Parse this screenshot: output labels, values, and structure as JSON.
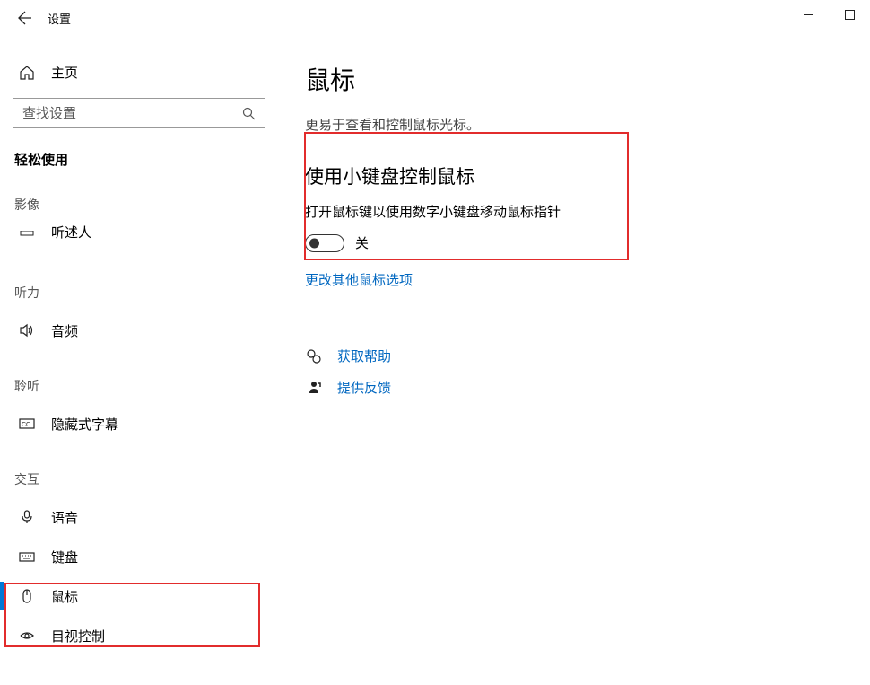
{
  "window": {
    "title": "设置"
  },
  "sidebar": {
    "home_label": "主页",
    "search_placeholder": "查找设置",
    "main_title": "轻松使用",
    "sections": {
      "vision": "影像",
      "hearing": "听力",
      "hearing2": "聆听",
      "interaction": "交互"
    },
    "items": {
      "partial": "听述人",
      "audio": "音频",
      "captions": "隐藏式字幕",
      "speech": "语音",
      "keyboard": "键盘",
      "mouse": "鼠标",
      "eyecontrol": "目视控制"
    }
  },
  "content": {
    "title": "鼠标",
    "subtitle": "更易于查看和控制鼠标光标。",
    "section_title": "使用小键盘控制鼠标",
    "section_desc": "打开鼠标键以使用数字小键盘移动鼠标指针",
    "toggle_state": "关",
    "link_more": "更改其他鼠标选项",
    "help": "获取帮助",
    "feedback": "提供反馈"
  }
}
